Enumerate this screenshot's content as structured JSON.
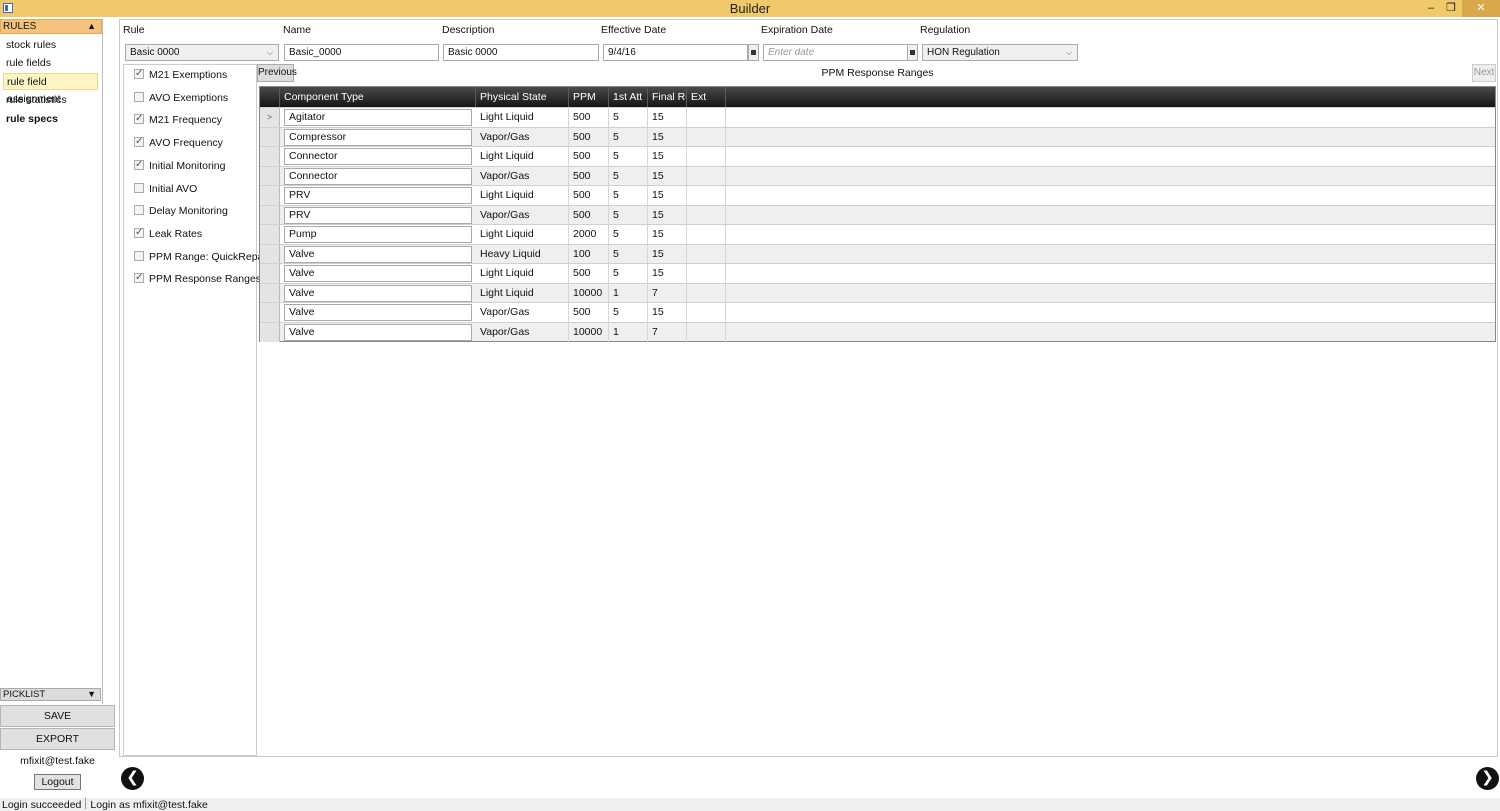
{
  "window": {
    "title": "Builder",
    "minimize": "‒",
    "maximize": "❐",
    "close": "✕"
  },
  "sidebar": {
    "header": "RULES",
    "items": [
      {
        "label": "stock rules"
      },
      {
        "label": "rule fields"
      },
      {
        "label": "rule field assignment"
      },
      {
        "label": "rule statistics"
      },
      {
        "label": "rule specs"
      }
    ],
    "picklist": "PICKLIST",
    "save": "SAVE",
    "export": "EXPORT",
    "user": "mfixit@test.fake",
    "logout": "Logout"
  },
  "form": {
    "rule_label": "Rule",
    "rule_value": "Basic 0000",
    "name_label": "Name",
    "name_value": "Basic_0000",
    "description_label": "Description",
    "description_value": "Basic 0000",
    "effective_label": "Effective Date",
    "effective_value": "9/4/16",
    "expiration_label": "Expiration Date",
    "expiration_placeholder": "Enter date",
    "regulation_label": "Regulation",
    "regulation_value": "HON Regulation"
  },
  "checklist": [
    {
      "label": "M21 Exemptions",
      "checked": true
    },
    {
      "label": "AVO Exemptions",
      "checked": false
    },
    {
      "label": "M21 Frequency",
      "checked": true
    },
    {
      "label": "AVO Frequency",
      "checked": true
    },
    {
      "label": "Initial Monitoring",
      "checked": true
    },
    {
      "label": "Initial AVO",
      "checked": false
    },
    {
      "label": "Delay Monitoring",
      "checked": false
    },
    {
      "label": "Leak Rates",
      "checked": true
    },
    {
      "label": "PPM Range: QuickRepair",
      "checked": false
    },
    {
      "label": "PPM Response Ranges",
      "checked": true
    }
  ],
  "grid": {
    "previous": "Previous",
    "next": "Next",
    "title": "PPM Response Ranges",
    "columns": [
      "Component Type",
      "Physical State",
      "PPM",
      "1st Att",
      "Final Re",
      "Ext"
    ],
    "rows": [
      [
        "Agitator",
        "Light Liquid",
        "500",
        "5",
        "15",
        ""
      ],
      [
        "Compressor",
        "Vapor/Gas",
        "500",
        "5",
        "15",
        ""
      ],
      [
        "Connector",
        "Light Liquid",
        "500",
        "5",
        "15",
        ""
      ],
      [
        "Connector",
        "Vapor/Gas",
        "500",
        "5",
        "15",
        ""
      ],
      [
        "PRV",
        "Light Liquid",
        "500",
        "5",
        "15",
        ""
      ],
      [
        "PRV",
        "Vapor/Gas",
        "500",
        "5",
        "15",
        ""
      ],
      [
        "Pump",
        "Light Liquid",
        "2000",
        "5",
        "15",
        ""
      ],
      [
        "Valve",
        "Heavy Liquid",
        "100",
        "5",
        "15",
        ""
      ],
      [
        "Valve",
        "Light Liquid",
        "500",
        "5",
        "15",
        ""
      ],
      [
        "Valve",
        "Light Liquid",
        "10000",
        "1",
        "7",
        ""
      ],
      [
        "Valve",
        "Vapor/Gas",
        "500",
        "5",
        "15",
        ""
      ],
      [
        "Valve",
        "Vapor/Gas",
        "10000",
        "1",
        "7",
        ""
      ]
    ],
    "selected_marker": ">"
  },
  "bottom": {
    "back": "❮",
    "forward": "❯"
  },
  "status": {
    "left": "Login succeeded",
    "right": "Login as mfixit@test.fake"
  }
}
